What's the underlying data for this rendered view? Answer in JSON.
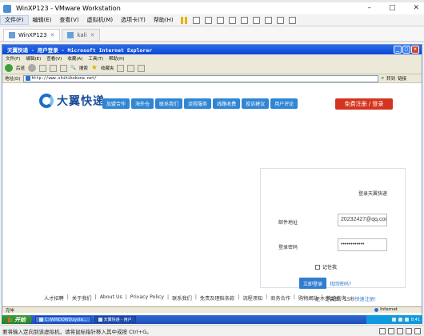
{
  "vmware": {
    "title": "WinXP123 - VMware Workstation",
    "window_buttons": [
      "–",
      "□",
      "✕"
    ],
    "menu": [
      "文件(F)",
      "编辑(E)",
      "查看(V)",
      "虚拟机(M)",
      "选项卡(T)",
      "帮助(H)"
    ],
    "tabs": [
      {
        "label": "WinXP123",
        "close": "✕"
      },
      {
        "label": "kali",
        "close": "✕"
      }
    ],
    "status_text": "要将输入定向到该虚拟机，请将鼠标指针移入其中或按 Ctrl+G。"
  },
  "ie": {
    "title": "天翼快递 - 用户登录 - Microsoft Internet Explorer",
    "menu": [
      "文件(F)",
      "编辑(E)",
      "查看(V)",
      "收藏(A)",
      "工具(T)",
      "帮助(H)"
    ],
    "toolbar": {
      "back": "后退",
      "search": "搜索",
      "favorites": "收藏夹"
    },
    "address_label": "地址(D)",
    "url": "http://www.shihikokona.net/",
    "go_label": "转到",
    "links_label": "链接",
    "status_left": "完毕",
    "status_zone": "Internet"
  },
  "site": {
    "logo_text": "大翼快递",
    "nav": [
      "加盟合作",
      "海外仓",
      "联系我们",
      "流程服务",
      "线路收费",
      "投诉建议",
      "用户评论"
    ],
    "register_label": "免费注册 / 登录",
    "login": {
      "title": "登录天翼快递",
      "email_label": "邮件地址",
      "email_value": "20232427@qq.com",
      "password_label": "登录密码",
      "password_value": "••••••••••••",
      "remember_label": "记住我",
      "submit_label": "立即登录",
      "forgot_label": "找回密码?",
      "not_member_prefix": "还不是会员，15秒",
      "not_member_link": "快速注册!"
    },
    "footer": [
      "人才招聘",
      "关于我们",
      "About Us",
      "Privacy Policy",
      "联系我们",
      "免责及理赔条款",
      "流程须知",
      "商务合作",
      "购物網站",
      "快递查询"
    ]
  },
  "xp_taskbar": {
    "start_label": "开始",
    "tasks": [
      "C:\\WINDOWS\\syste...",
      "天翼快递 - 用户"
    ],
    "clock": "8:41"
  }
}
